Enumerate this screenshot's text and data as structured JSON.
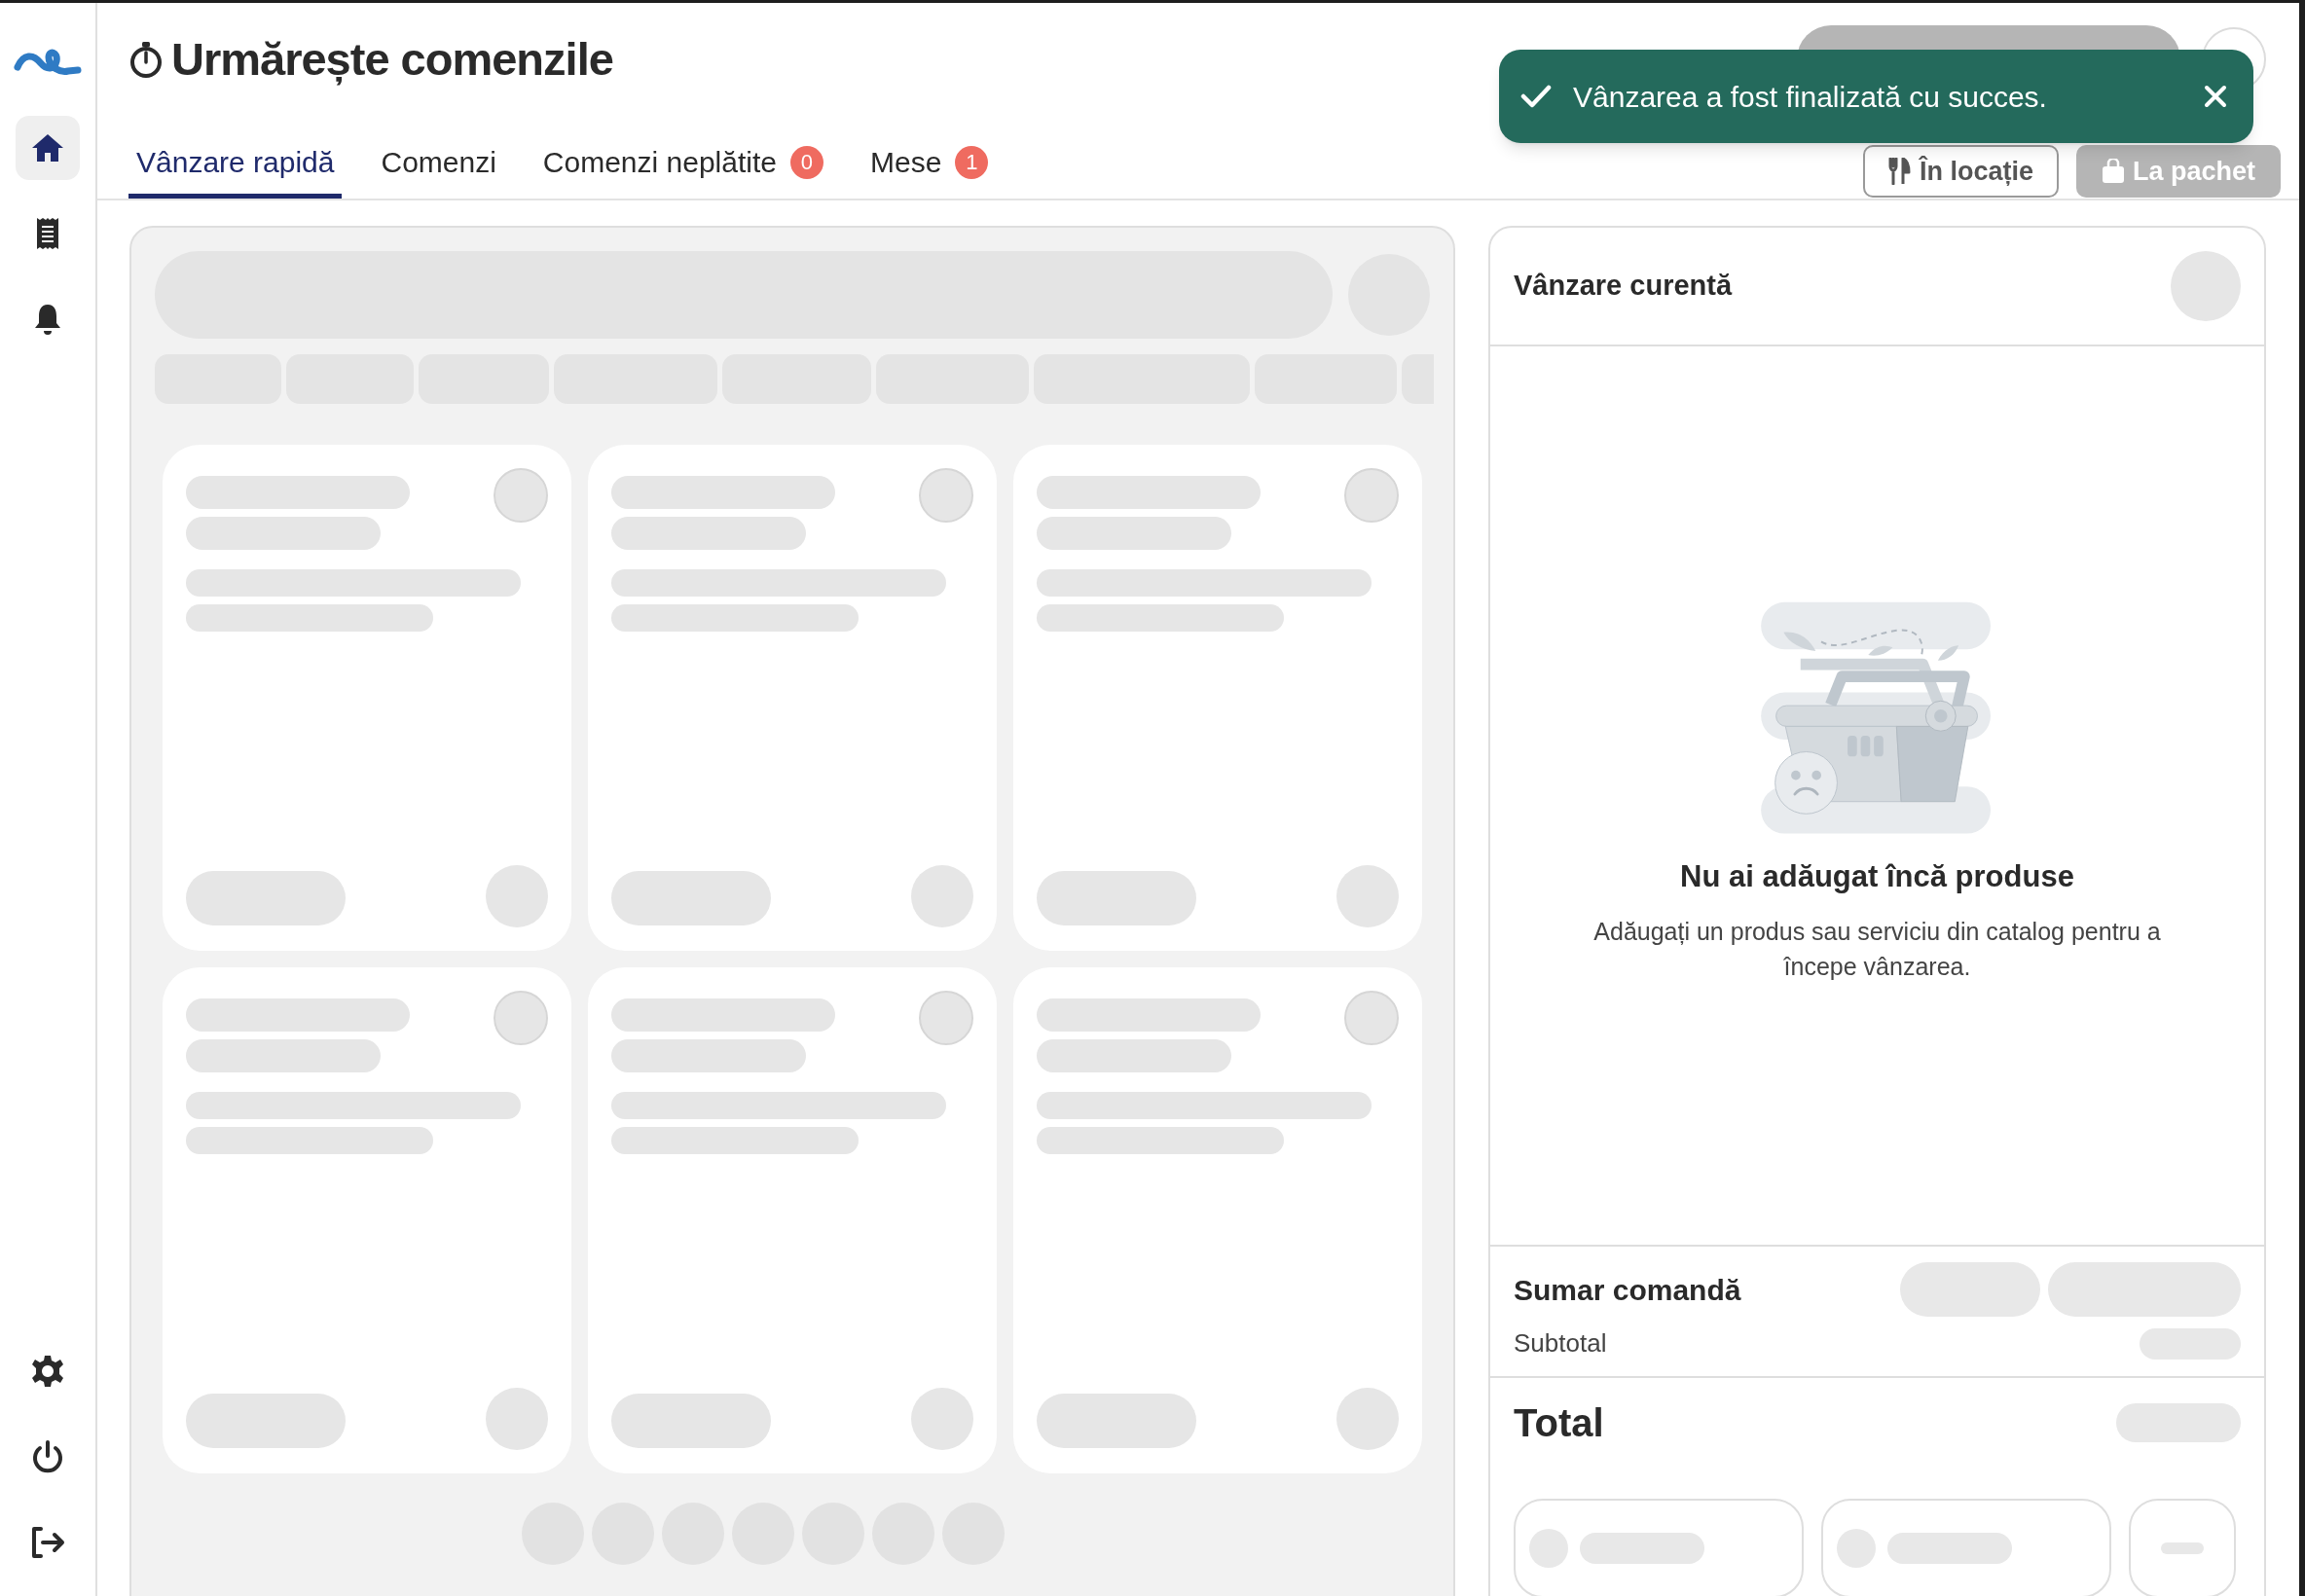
{
  "sidebar": {
    "items": [
      {
        "selected": true
      },
      {
        "selected": false
      },
      {
        "selected": false
      },
      {
        "selected": false
      },
      {
        "selected": false
      },
      {
        "selected": false
      }
    ]
  },
  "header": {
    "title": "Urmărește comenzile"
  },
  "tabs": [
    {
      "label": "Vânzare rapidă",
      "selected": true
    },
    {
      "label": "Comenzi",
      "selected": false
    },
    {
      "label": "Comenzi neplătite",
      "badge": "0",
      "selected": false
    },
    {
      "label": "Mese",
      "badge": "1",
      "selected": false
    }
  ],
  "order_type_buttons": [
    {
      "label": "În locație",
      "disabled": false
    },
    {
      "label": "La pachet",
      "disabled": true
    }
  ],
  "toast": {
    "message": "Vânzarea a fost finalizată cu succes."
  },
  "current_sale": {
    "title": "Vânzare curentă",
    "empty_title": "Nu ai adăugat încă produse",
    "empty_text": "Adăugați un produs sau serviciu din catalog pentru a începe vânzarea."
  },
  "summary": {
    "title": "Sumar comandă",
    "subtotal_label": "Subtotal",
    "total_label": "Total"
  }
}
